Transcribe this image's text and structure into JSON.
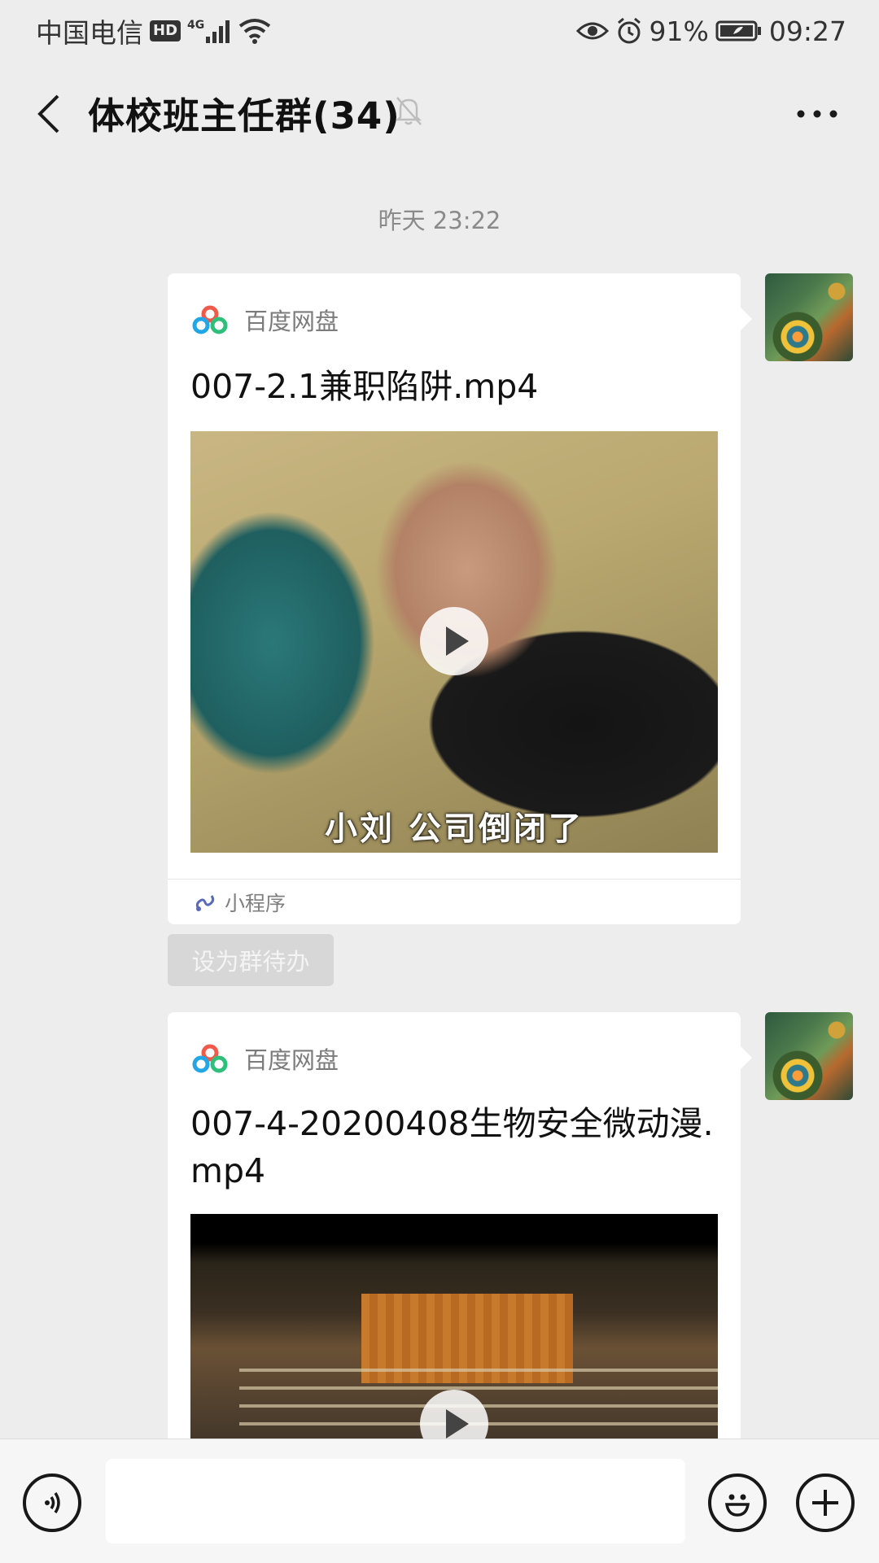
{
  "status_bar": {
    "carrier": "中国电信",
    "hd": "HD",
    "network": "4G",
    "battery": "91%",
    "time": "09:27"
  },
  "nav": {
    "title": "体校班主任群(34)"
  },
  "chat": {
    "timestamp": "昨天 23:22",
    "messages": [
      {
        "source": "百度网盘",
        "title": "007-2.1兼职陷阱.mp4",
        "subtitle": "小刘  公司倒闭了",
        "footer": "小程序"
      },
      {
        "source": "百度网盘",
        "title": "007-4-20200408生物安全微动漫.mp4"
      }
    ],
    "todo_label": "设为群待办"
  },
  "colors": {
    "background": "#ededed",
    "bubble": "#ffffff",
    "muted_text": "#8a8a8a"
  }
}
